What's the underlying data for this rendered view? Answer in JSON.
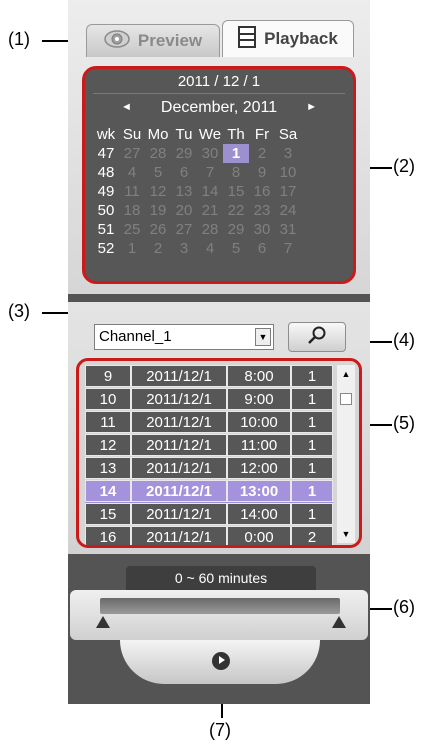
{
  "callouts": [
    "(1)",
    "(2)",
    "(3)",
    "(4)",
    "(5)",
    "(6)",
    "(7)"
  ],
  "tabs": {
    "preview": "Preview",
    "playback": "Playback"
  },
  "calendar": {
    "date": "2011 / 12 / 1",
    "month": "December, 2011",
    "prev": "◄",
    "next": "►",
    "headers": [
      "wk",
      "Su",
      "Mo",
      "Tu",
      "We",
      "Th",
      "Fr",
      "Sa"
    ],
    "rows": [
      {
        "wk": "47",
        "days": [
          "27",
          "28",
          "29",
          "30",
          "1",
          "2",
          "3"
        ],
        "states": [
          "dim",
          "dim",
          "dim",
          "dim",
          "sel",
          "dim",
          "dim"
        ]
      },
      {
        "wk": "48",
        "days": [
          "4",
          "5",
          "6",
          "7",
          "8",
          "9",
          "10"
        ],
        "states": [
          "dim",
          "dim",
          "dim",
          "dim",
          "dim",
          "dim",
          "dim"
        ]
      },
      {
        "wk": "49",
        "days": [
          "11",
          "12",
          "13",
          "14",
          "15",
          "16",
          "17"
        ],
        "states": [
          "dim",
          "dim",
          "dim",
          "dim",
          "dim",
          "dim",
          "dim"
        ]
      },
      {
        "wk": "50",
        "days": [
          "18",
          "19",
          "20",
          "21",
          "22",
          "23",
          "24"
        ],
        "states": [
          "dim",
          "dim",
          "dim",
          "dim",
          "dim",
          "dim",
          "dim"
        ]
      },
      {
        "wk": "51",
        "days": [
          "25",
          "26",
          "27",
          "28",
          "29",
          "30",
          "31"
        ],
        "states": [
          "dim",
          "dim",
          "dim",
          "dim",
          "dim",
          "dim",
          "dim"
        ]
      },
      {
        "wk": "52",
        "days": [
          "1",
          "2",
          "3",
          "4",
          "5",
          "6",
          "7"
        ],
        "states": [
          "dim",
          "dim",
          "dim",
          "dim",
          "dim",
          "dim",
          "dim"
        ]
      }
    ]
  },
  "channel": {
    "value": "Channel_1"
  },
  "records": [
    [
      "9",
      "2011/12/1",
      "8:00",
      "1"
    ],
    [
      "10",
      "2011/12/1",
      "9:00",
      "1"
    ],
    [
      "11",
      "2011/12/1",
      "10:00",
      "1"
    ],
    [
      "12",
      "2011/12/1",
      "11:00",
      "1"
    ],
    [
      "13",
      "2011/12/1",
      "12:00",
      "1"
    ],
    [
      "14",
      "2011/12/1",
      "13:00",
      "1"
    ],
    [
      "15",
      "2011/12/1",
      "14:00",
      "1"
    ],
    [
      "16",
      "2011/12/1",
      "0:00",
      "2"
    ]
  ],
  "selected_record_index": 5,
  "time_range": "0 ~ 60 minutes",
  "colors": {
    "highlight": "#cc1a1a",
    "selection": "#a492dc",
    "panel": "#575757"
  }
}
